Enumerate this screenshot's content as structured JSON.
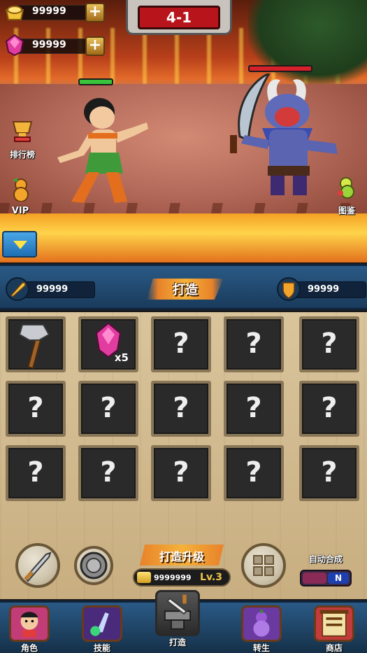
{
  "currency": {
    "gold": {
      "icon": "gold-ingot-icon",
      "value": "99999",
      "plus": "+"
    },
    "gem": {
      "icon": "pink-gem-icon",
      "value": "99999",
      "plus": "+"
    }
  },
  "stage": {
    "label": "4-1"
  },
  "side_left": {
    "ranking_label": "排行榜",
    "vip_label": "VIP"
  },
  "side_right": {
    "label": "图鉴"
  },
  "stats": {
    "attack": {
      "icon": "sword-icon",
      "value": "99999"
    },
    "defense": {
      "icon": "shield-icon",
      "value": "99999"
    },
    "title": "打造"
  },
  "grid": {
    "slots": [
      {
        "kind": "item",
        "icon": "axe-icon",
        "count": ""
      },
      {
        "kind": "item",
        "icon": "gem-icon",
        "count": "x5"
      },
      {
        "kind": "unknown",
        "q": "?"
      },
      {
        "kind": "unknown",
        "q": "?"
      },
      {
        "kind": "unknown",
        "q": "?"
      },
      {
        "kind": "unknown",
        "q": "?"
      },
      {
        "kind": "unknown",
        "q": "?"
      },
      {
        "kind": "unknown",
        "q": "?"
      },
      {
        "kind": "unknown",
        "q": "?"
      },
      {
        "kind": "unknown",
        "q": "?"
      },
      {
        "kind": "unknown",
        "q": "?"
      },
      {
        "kind": "unknown",
        "q": "?"
      },
      {
        "kind": "unknown",
        "q": "?"
      },
      {
        "kind": "unknown",
        "q": "?"
      },
      {
        "kind": "unknown",
        "q": "?"
      }
    ]
  },
  "controls": {
    "upgrade_label": "打造升级",
    "upgrade_cost": "9999999",
    "upgrade_level": "Lv.3",
    "auto_label": "自动合成",
    "auto_state": "N"
  },
  "tabs": [
    {
      "label": "角色",
      "icon": "character-portrait-icon"
    },
    {
      "label": "技能",
      "icon": "skill-icon"
    },
    {
      "label": "打造",
      "icon": "anvil-icon",
      "active": true
    },
    {
      "label": "转生",
      "icon": "gourd-icon"
    },
    {
      "label": "商店",
      "icon": "shop-scroll-icon"
    }
  ]
}
